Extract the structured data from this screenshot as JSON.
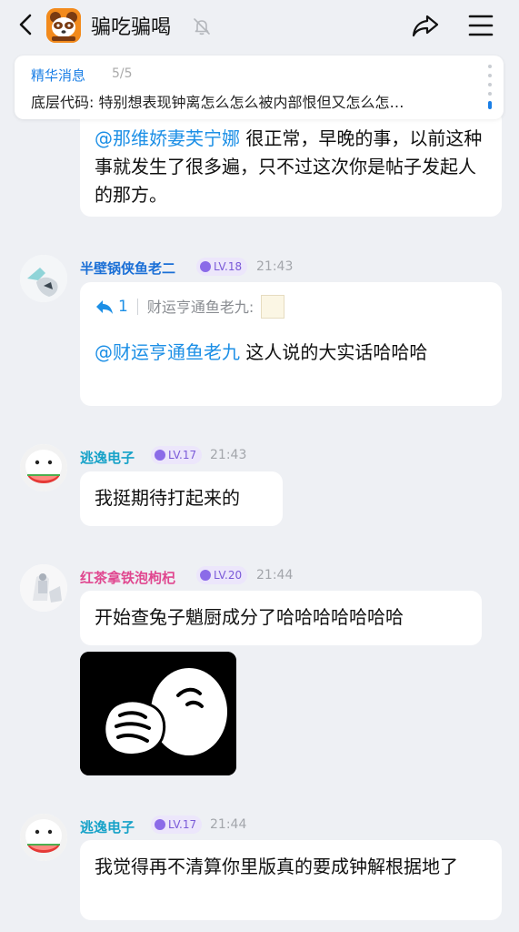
{
  "header": {
    "title": "骗吃骗喝"
  },
  "essence": {
    "title": "精华消息",
    "count": "5/5",
    "text": "底层代码: 特别想表现钟离怎么怎么被内部恨但又怎么怎…"
  },
  "messages": [
    {
      "mention": "@那维娇妻芙宁娜",
      "text": " 很正常，早晚的事，以前这种事就发生了很多遍，只不过这次你是帖子发起人的那方。"
    },
    {
      "nickname": "半壁锅侠鱼老二",
      "level": "LV.18",
      "time": "21:43",
      "reply_count": "1",
      "reply_to": "财运亨通鱼老九:",
      "mention": "@财运亨通鱼老九",
      "text": " 这人说的大实话哈哈哈"
    },
    {
      "nickname": "逃逸电子",
      "level": "LV.17",
      "time": "21:43",
      "text": "我挺期待打起来的"
    },
    {
      "nickname": "红茶拿铁泡枸杞",
      "level": "LV.20",
      "time": "21:44",
      "text": "开始查兔子魈厨成分了哈哈哈哈哈哈哈"
    },
    {
      "nickname": "逃逸电子",
      "level": "LV.17",
      "time": "21:44",
      "text": "我觉得再不清算你里版真的要成钟解根据地了"
    }
  ],
  "colors": {
    "accent": "#1b7fe6",
    "mention": "#1c8fe6",
    "nick_blue": "#1a6fd6",
    "nick_cyan": "#17a2c8",
    "nick_pink": "#e0468f",
    "level_bg": "#ece6fb",
    "level_fg": "#7a5ad8"
  },
  "icons": {
    "back": "chevron-left-icon",
    "mute": "bell-off-icon",
    "share": "share-arrow-icon",
    "menu": "hamburger-menu-icon",
    "reply": "reply-arrow-icon"
  }
}
